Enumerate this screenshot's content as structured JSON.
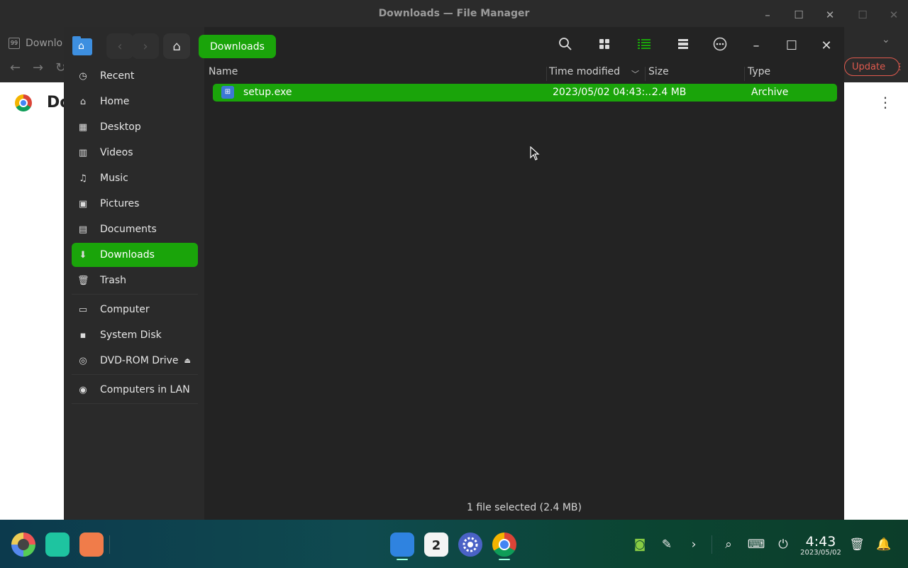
{
  "outer_window": {
    "title": "Downloads — File Manager",
    "tab_label": "Downlo",
    "favicon_text": "99",
    "update_label": "Update",
    "page_heading": "Do"
  },
  "file_manager": {
    "breadcrumb": "Downloads",
    "sidebar": {
      "items": [
        {
          "label": "Recent",
          "icon": "clock-icon"
        },
        {
          "label": "Home",
          "icon": "home-icon"
        },
        {
          "label": "Desktop",
          "icon": "desktop-icon"
        },
        {
          "label": "Videos",
          "icon": "video-icon"
        },
        {
          "label": "Music",
          "icon": "music-icon"
        },
        {
          "label": "Pictures",
          "icon": "picture-icon"
        },
        {
          "label": "Documents",
          "icon": "document-icon"
        },
        {
          "label": "Downloads",
          "icon": "download-icon"
        },
        {
          "label": "Trash",
          "icon": "trash-icon"
        },
        {
          "label": "Computer",
          "icon": "computer-icon"
        },
        {
          "label": "System Disk",
          "icon": "disk-icon"
        },
        {
          "label": "DVD-ROM Drive",
          "icon": "dvd-icon"
        },
        {
          "label": "Computers in LAN",
          "icon": "network-icon"
        }
      ],
      "active": "Downloads"
    },
    "columns": {
      "name": "Name",
      "time_modified": "Time modified",
      "size": "Size",
      "type": "Type"
    },
    "files": [
      {
        "name": "setup.exe",
        "time_modified": "2023/05/02 04:43:...",
        "size": "2.4 MB",
        "type": "Archive",
        "selected": true
      }
    ],
    "status": "1 file selected (2.4 MB)"
  },
  "taskbar": {
    "calendar_day": "2",
    "clock_time": "4:43",
    "clock_date": "2023/05/02"
  },
  "colors": {
    "accent": "#1aa40a",
    "window_bg": "#232323",
    "sidebar_bg": "#2a2a2a",
    "update_red": "#e05a4e"
  }
}
